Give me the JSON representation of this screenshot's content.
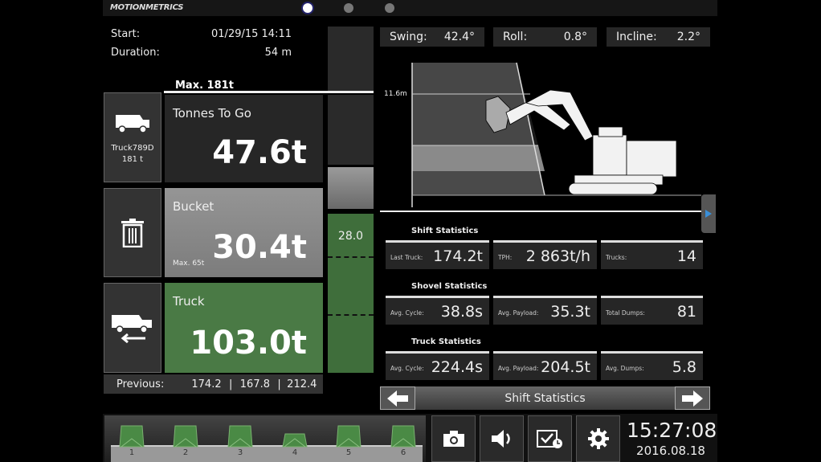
{
  "header": {
    "logo": "MOTIONMETRICS",
    "pages": [
      {
        "active": true
      },
      {
        "active": false
      },
      {
        "active": false
      }
    ]
  },
  "session": {
    "start_label": "Start:",
    "start_value": "01/29/15 14:11",
    "duration_label": "Duration:",
    "duration_value": "54 m"
  },
  "load": {
    "max_label": "Max. 181t",
    "gauge_value": "28.0"
  },
  "side_buttons": [
    {
      "icon": "truck-icon",
      "label": "Truck789D",
      "sub": "181 t"
    },
    {
      "icon": "trash-icon"
    },
    {
      "icon": "truck-dump-icon"
    }
  ],
  "tiles": {
    "tonnes_to_go": {
      "title": "Tonnes To Go",
      "value": "47.6t"
    },
    "bucket": {
      "title": "Bucket",
      "value": "30.4t",
      "sub": "Max. 65t"
    },
    "truck": {
      "title": "Truck",
      "value": "103.0t"
    }
  },
  "previous": {
    "label": "Previous:",
    "values": [
      "174.2",
      "167.8",
      "212.4"
    ]
  },
  "angles": [
    {
      "label": "Swing:",
      "value": "42.4°"
    },
    {
      "label": "Roll:",
      "value": "0.8°"
    },
    {
      "label": "Incline:",
      "value": "2.2°"
    }
  ],
  "diagram": {
    "height_label": "11.6m"
  },
  "stats": [
    {
      "title": "Shift Statistics",
      "cards": [
        {
          "k": "Last Truck:",
          "v": "174.2t"
        },
        {
          "k": "TPH:",
          "v": "2 863t/h"
        },
        {
          "k": "Trucks:",
          "v": "14"
        }
      ]
    },
    {
      "title": "Shovel Statistics",
      "cards": [
        {
          "k": "Avg. Cycle:",
          "v": "38.8s"
        },
        {
          "k": "Avg. Payload:",
          "v": "35.3t"
        },
        {
          "k": "Total Dumps:",
          "v": "81"
        }
      ]
    },
    {
      "title": "Truck Statistics",
      "cards": [
        {
          "k": "Avg. Cycle:",
          "v": "224.4s"
        },
        {
          "k": "Avg. Payload:",
          "v": "204.5t"
        },
        {
          "k": "Avg. Dumps:",
          "v": "5.8"
        }
      ]
    }
  ],
  "nav": {
    "title": "Shift Statistics"
  },
  "buckets": [
    {
      "n": "1"
    },
    {
      "n": "2"
    },
    {
      "n": "3"
    },
    {
      "n": "4"
    },
    {
      "n": "5"
    },
    {
      "n": "6"
    }
  ],
  "toolbar": [
    "camera-icon",
    "speaker-icon",
    "schedule-icon",
    "gear-icon"
  ],
  "clock": {
    "time": "15:27:08",
    "date": "2016.08.18"
  },
  "colors": {
    "green": "#4a7a45",
    "bucket_gray": "#8c8c8c",
    "accent_blue": "#3a8fd8"
  }
}
